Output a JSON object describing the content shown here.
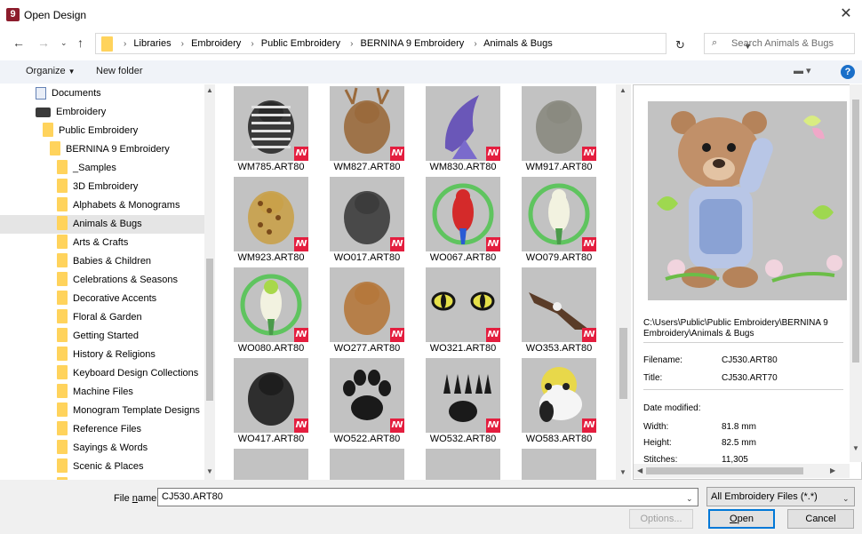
{
  "window": {
    "app_icon": "9",
    "title": "Open Design",
    "close": "✕"
  },
  "nav": {
    "breadcrumbs": [
      "Libraries",
      "Embroidery",
      "Public Embroidery",
      "BERNINA 9 Embroidery",
      "Animals & Bugs"
    ],
    "search_placeholder": "Search Animals & Bugs"
  },
  "toolbar": {
    "organize": "Organize",
    "new_folder": "New folder",
    "help": "?"
  },
  "tree": [
    {
      "label": "Documents",
      "icon": "doc"
    },
    {
      "label": "Embroidery",
      "icon": "emb"
    },
    {
      "label": "Public Embroidery",
      "icon": "folder"
    },
    {
      "label": "BERNINA 9 Embroidery",
      "icon": "folder"
    },
    {
      "label": "_Samples",
      "icon": "folder"
    },
    {
      "label": "3D Embroidery",
      "icon": "folder"
    },
    {
      "label": "Alphabets & Monograms",
      "icon": "folder"
    },
    {
      "label": "Animals & Bugs",
      "icon": "folder",
      "selected": true
    },
    {
      "label": "Arts & Crafts",
      "icon": "folder"
    },
    {
      "label": "Babies & Children",
      "icon": "folder"
    },
    {
      "label": "Celebrations & Seasons",
      "icon": "folder"
    },
    {
      "label": "Decorative Accents",
      "icon": "folder"
    },
    {
      "label": "Floral & Garden",
      "icon": "folder"
    },
    {
      "label": "Getting Started",
      "icon": "folder"
    },
    {
      "label": "History & Religions",
      "icon": "folder"
    },
    {
      "label": "Keyboard Design Collections",
      "icon": "folder"
    },
    {
      "label": "Machine Files",
      "icon": "folder"
    },
    {
      "label": "Monogram Template Designs",
      "icon": "folder"
    },
    {
      "label": "Reference Files",
      "icon": "folder"
    },
    {
      "label": "Sayings & Words",
      "icon": "folder"
    },
    {
      "label": "Scenic & Places",
      "icon": "folder"
    }
  ],
  "files": [
    {
      "name": "WM785.ART80",
      "subject": "zebra",
      "color": "#2a2a2a"
    },
    {
      "name": "WM827.ART80",
      "subject": "deer",
      "color": "#9a6a3c"
    },
    {
      "name": "WM830.ART80",
      "subject": "dolphin",
      "color": "#6a57b8"
    },
    {
      "name": "WM917.ART80",
      "subject": "elephant",
      "color": "#8a8a80"
    },
    {
      "name": "WM923.ART80",
      "subject": "giraffe",
      "color": "#c9a14a"
    },
    {
      "name": "WO017.ART80",
      "subject": "horse",
      "color": "#3c3c3c"
    },
    {
      "name": "WO067.ART80",
      "subject": "parrot",
      "color": "#d42a2a"
    },
    {
      "name": "WO079.ART80",
      "subject": "cockatoo",
      "color": "#3cba3c"
    },
    {
      "name": "WO080.ART80",
      "subject": "parakeet",
      "color": "#45b36a"
    },
    {
      "name": "WO277.ART80",
      "subject": "bear head",
      "color": "#b5783c"
    },
    {
      "name": "WO321.ART80",
      "subject": "cat eyes",
      "color": "#151515"
    },
    {
      "name": "WO353.ART80",
      "subject": "eagle",
      "color": "#5a3c28"
    },
    {
      "name": "WO417.ART80",
      "subject": "dog",
      "color": "#1e1e1e"
    },
    {
      "name": "WO522.ART80",
      "subject": "paw print",
      "color": "#1a1a1a"
    },
    {
      "name": "WO532.ART80",
      "subject": "claw print",
      "color": "#1a1a1a"
    },
    {
      "name": "WO583.ART80",
      "subject": "panda",
      "color": "#222222"
    }
  ],
  "file_badge": "ꟿ",
  "preview": {
    "path": "C:\\Users\\Public\\Public Embroidery\\BERNINA 9 Embroidery\\Animals & Bugs",
    "filename_label": "Filename:",
    "filename": "CJ530.ART80",
    "title_label": "Title:",
    "title": "CJ530.ART70",
    "date_label": "Date modified:",
    "date": "",
    "width_label": "Width:",
    "width": "81.8 mm",
    "height_label": "Height:",
    "height": "82.5 mm",
    "stitches_label": "Stitches:",
    "stitches": "11,305"
  },
  "bottom": {
    "file_name_label_pre": "File ",
    "file_name_label_u": "n",
    "file_name_label_post": "ame:",
    "file_name_value": "CJ530.ART80",
    "file_type": "All Embroidery Files (*.*)",
    "options": "Options...",
    "open_u": "O",
    "open_rest": "pen",
    "cancel": "Cancel"
  },
  "colors": {
    "accent": "#0078d7",
    "badge": "#e41e3f",
    "folder": "#ffd35c",
    "thumb_bg": "#c2c2c2"
  }
}
